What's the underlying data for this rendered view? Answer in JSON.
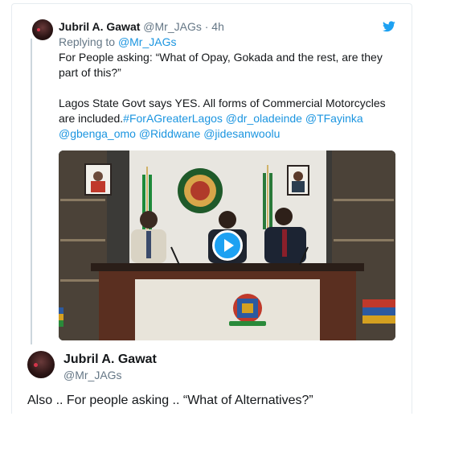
{
  "quoted_tweet": {
    "name": "Jubril A. Gawat",
    "handle": "@Mr_JAGs",
    "separator": "·",
    "time": "4h",
    "replying_prefix": "Replying to",
    "replying_to": "@Mr_JAGs",
    "paragraph1": "For People asking: “What of Opay, Gokada and the rest, are they part of this?”",
    "paragraph2_text": "Lagos State Govt says YES. All forms of Commercial Motorcycles are included.",
    "links": [
      "#ForAGreaterLagos",
      "@dr_oladeinde",
      "@TFayinka",
      "@gbenga_omo",
      "@Riddwane",
      "@jidesanwoolu"
    ],
    "media": {
      "type": "video",
      "play_icon": "play-icon"
    }
  },
  "tweet": {
    "name": "Jubril A. Gawat",
    "handle": "@Mr_JAGs",
    "text": "Also .. For people asking .. “What of Alternatives?”"
  },
  "colors": {
    "link": "#1b95e0",
    "twitter_blue": "#1da1f2",
    "muted": "#657786",
    "text": "#14171a"
  }
}
